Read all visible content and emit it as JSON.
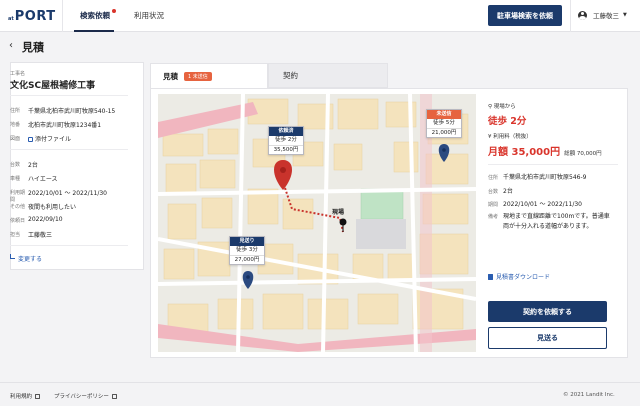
{
  "header": {
    "logo_small": "at",
    "logo_big": "PORT",
    "nav": [
      "検索依頼",
      "利用状況"
    ],
    "search_button": "駐車場検索を依頼",
    "user_name": "工藤敬三"
  },
  "page": {
    "title": "見積"
  },
  "project": {
    "label": "工事名",
    "name": "文化SC屋根補修工事",
    "rows": [
      {
        "k": "住所",
        "v": "千葉県北柏市武川町牧原540-15"
      },
      {
        "k": "地番",
        "v": "北柏市武川町牧原1234番1"
      },
      {
        "k": "図面",
        "v": "添付ファイル"
      },
      {
        "k": "台数",
        "v": "2台"
      },
      {
        "k": "車種",
        "v": "ハイエース"
      },
      {
        "k": "利用期間",
        "v": "2022/10/01 〜 2022/11/30"
      },
      {
        "k": "その他",
        "v": "夜間も利用したい"
      },
      {
        "k": "依頼日",
        "v": "2022/09/10"
      },
      {
        "k": "担当",
        "v": "工藤敬三"
      }
    ],
    "edit_link": "変更する"
  },
  "tabs": {
    "estimate": "見積",
    "estimate_badge": "1 未送信",
    "contract": "契約"
  },
  "map": {
    "site_label": "現場",
    "callouts": [
      {
        "header": "依頼済",
        "walk": "徒歩 2分",
        "price": "35,500円",
        "color": "#1b3a6b"
      },
      {
        "header": "未送信",
        "walk": "徒歩 5分",
        "price": "21,000円",
        "color": "#e6633f"
      },
      {
        "header": "見送り",
        "walk": "徒歩 3分",
        "price": "27,000円",
        "color": "#1b3a6b"
      }
    ],
    "colors": {
      "selected_pin": "#c9332c",
      "other_pin": "#2b4a80"
    }
  },
  "detail": {
    "from_site_label": "現場から",
    "walk_time": "徒歩 2分",
    "fee_label": "利用料（税抜）",
    "monthly_price": "月額 35,000円",
    "total_price": "総額 70,000円",
    "rows": [
      {
        "k": "住所",
        "v": "千葉県北柏市武川町牧原546-9"
      },
      {
        "k": "台数",
        "v": "2台"
      },
      {
        "k": "期間",
        "v": "2022/10/01 〜 2022/11/30"
      },
      {
        "k": "備考",
        "v": "現地まで直線距離で100mです。普通車両が十分入れる道幅があります。"
      }
    ],
    "download": "見積書ダウンロード",
    "request_contract": "契約を依頼する",
    "skip": "見送る"
  },
  "footer": {
    "terms": "利用規約",
    "privacy": "プライバシーポリシー",
    "copyright": "© 2021 Landit Inc."
  }
}
